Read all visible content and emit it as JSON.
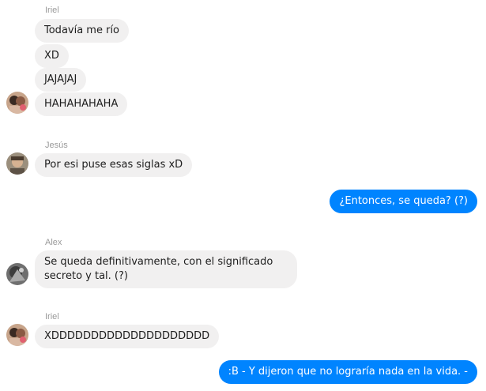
{
  "conversation": {
    "groups": [
      {
        "sender": "Iriel",
        "messages": [
          "Todavía me río",
          "XD",
          "JAJAJAJ",
          "HAHAHAHAHA"
        ]
      },
      {
        "sender": "Jesús",
        "messages": [
          "Por esi puse esas siglas xD"
        ]
      },
      {
        "sender": "me",
        "messages": [
          "¿Entonces, se queda? (?)"
        ]
      },
      {
        "sender": "Alex",
        "messages": [
          "Se queda definitivamente, con el significado secreto y tal. (?)"
        ]
      },
      {
        "sender": "Iriel",
        "messages": [
          "XDDDDDDDDDDDDDDDDDDDD"
        ]
      },
      {
        "sender": "me",
        "messages": [
          ":B - Y dijeron que no lograría nada en la vida. -"
        ]
      }
    ]
  },
  "colors": {
    "incoming_bubble": "#f1f0f0",
    "outgoing_bubble": "#0084ff",
    "sender_name": "#9a9a9a"
  }
}
